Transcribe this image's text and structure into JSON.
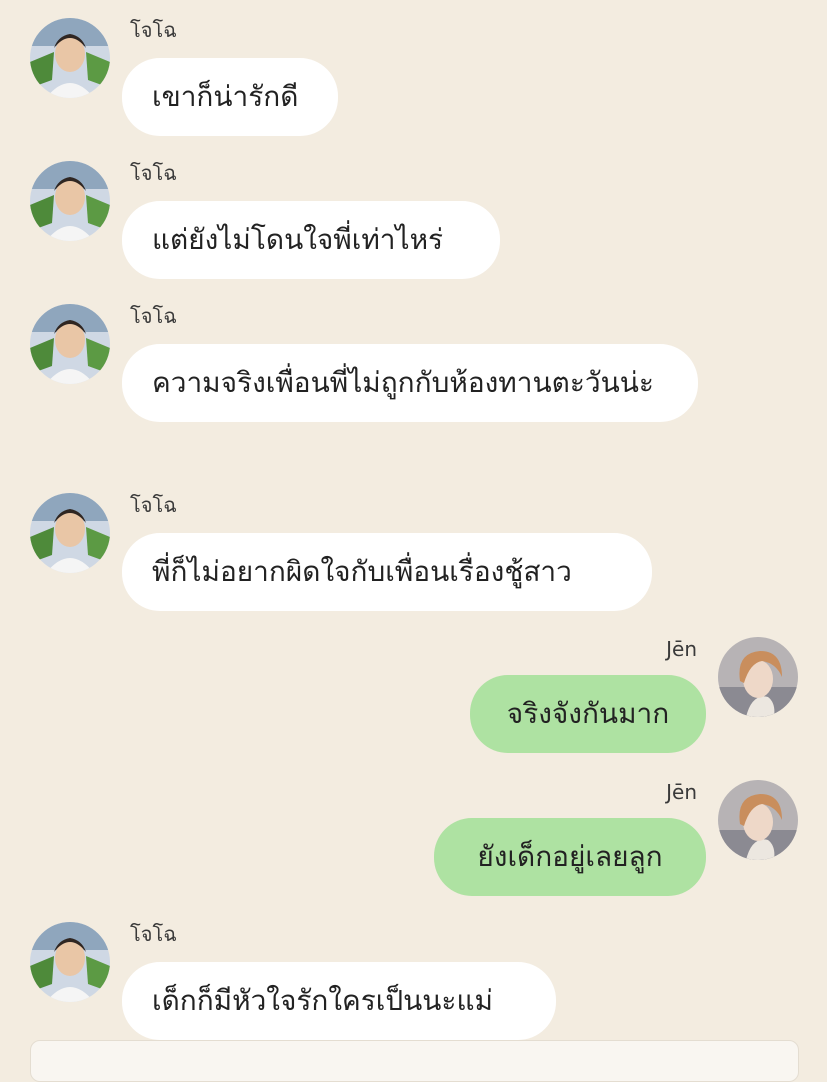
{
  "chat": {
    "messages": [
      {
        "sender": "โจโฉ",
        "text": "เขาก็น่ารักดี",
        "direction": "incoming"
      },
      {
        "sender": "โจโฉ",
        "text": "แต่ยังไม่โดนใจพี่เท่าไหร่",
        "direction": "incoming"
      },
      {
        "sender": "โจโฉ",
        "text": "ความจริงเพื่อนพี่ไม่ถูกกับห้องทานตะวันน่ะ",
        "direction": "incoming"
      },
      {
        "sender": "โจโฉ",
        "text": "พี่ก็ไม่อยากผิดใจกับเพื่อนเรื่องชู้สาว",
        "direction": "incoming"
      },
      {
        "sender": "Jēn",
        "text": "จริงจังกันมาก",
        "direction": "outgoing"
      },
      {
        "sender": "Jēn",
        "text": "ยังเด็กอยู่เลยลูก",
        "direction": "outgoing"
      },
      {
        "sender": "โจโฉ",
        "text": "เด็กก็มีหัวใจรักใครเป็นนะแม่",
        "direction": "incoming"
      }
    ]
  },
  "colors": {
    "background": "#f3ece0",
    "incoming_bubble": "#ffffff",
    "outgoing_bubble": "#aee2a2"
  },
  "icons": {
    "incoming_avatar": "boy-photo-avatar",
    "outgoing_avatar": "profile-photo-avatar"
  }
}
